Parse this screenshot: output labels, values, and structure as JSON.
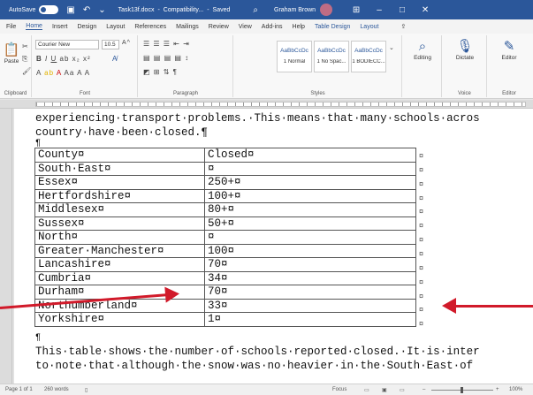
{
  "titlebar": {
    "autosave_label": "AutoSave",
    "autosave_state": "On",
    "filename": "Task13f.docx",
    "mode": "Compatibility...",
    "saved": "Saved",
    "user": "Graham Brown"
  },
  "menu": [
    "File",
    "Home",
    "Insert",
    "Design",
    "Layout",
    "References",
    "Mailings",
    "Review",
    "View",
    "Add-ins",
    "Help",
    "Table Design",
    "Layout"
  ],
  "ribbon": {
    "clipboard": {
      "paste": "Paste",
      "label": "Clipboard"
    },
    "font": {
      "name": "Courier New",
      "size": "10.5",
      "label": "Font"
    },
    "paragraph": {
      "label": "Paragraph"
    },
    "styles": {
      "items": [
        {
          "sample": "AaBbCcDc",
          "name": "1 Normal"
        },
        {
          "sample": "AaBbCcDc",
          "name": "1 No Spac..."
        },
        {
          "sample": "AaBbCcDc",
          "name": "1 BODIECC..."
        }
      ],
      "label": "Styles"
    },
    "editing": "Editing",
    "dictate": "Dictate",
    "editor": "Editor",
    "voice_label": "Voice",
    "editor_label": "Editor"
  },
  "document": {
    "intro_line1": "experiencing·transport·problems.·This·means·that·many·schools·acros",
    "intro_line2": "country·have·been·closed.¶",
    "pilcrow": "¶",
    "table": [
      [
        "County¤",
        "Closed¤"
      ],
      [
        "South·East¤",
        "¤"
      ],
      [
        "Essex¤",
        "250+¤"
      ],
      [
        "Hertfordshire¤",
        "100+¤"
      ],
      [
        "Middlesex¤",
        "80+¤"
      ],
      [
        "Sussex¤",
        "50+¤"
      ],
      [
        "North¤",
        "¤"
      ],
      [
        "Greater·Manchester¤",
        "100¤"
      ],
      [
        "Lancashire¤",
        "70¤"
      ],
      [
        "Cumbria¤",
        "34¤"
      ],
      [
        "Durham¤",
        "70¤"
      ],
      [
        "Northumberland¤",
        "33¤"
      ],
      [
        "Yorkshire¤",
        "1¤"
      ]
    ],
    "row_end_mark": "¤",
    "after_line1": "This·table·shows·the·number·of·schools·reported·closed.·It·is·inter",
    "after_line2": "to·note·that·although·the·snow·was·no·heavier·in·the·South·East·of"
  },
  "status": {
    "page": "Page 1 of 1",
    "words": "260 words",
    "focus": "Focus",
    "zoom": "100%"
  },
  "colors": {
    "accent": "#2b579a",
    "arrow": "#d11a2a"
  }
}
